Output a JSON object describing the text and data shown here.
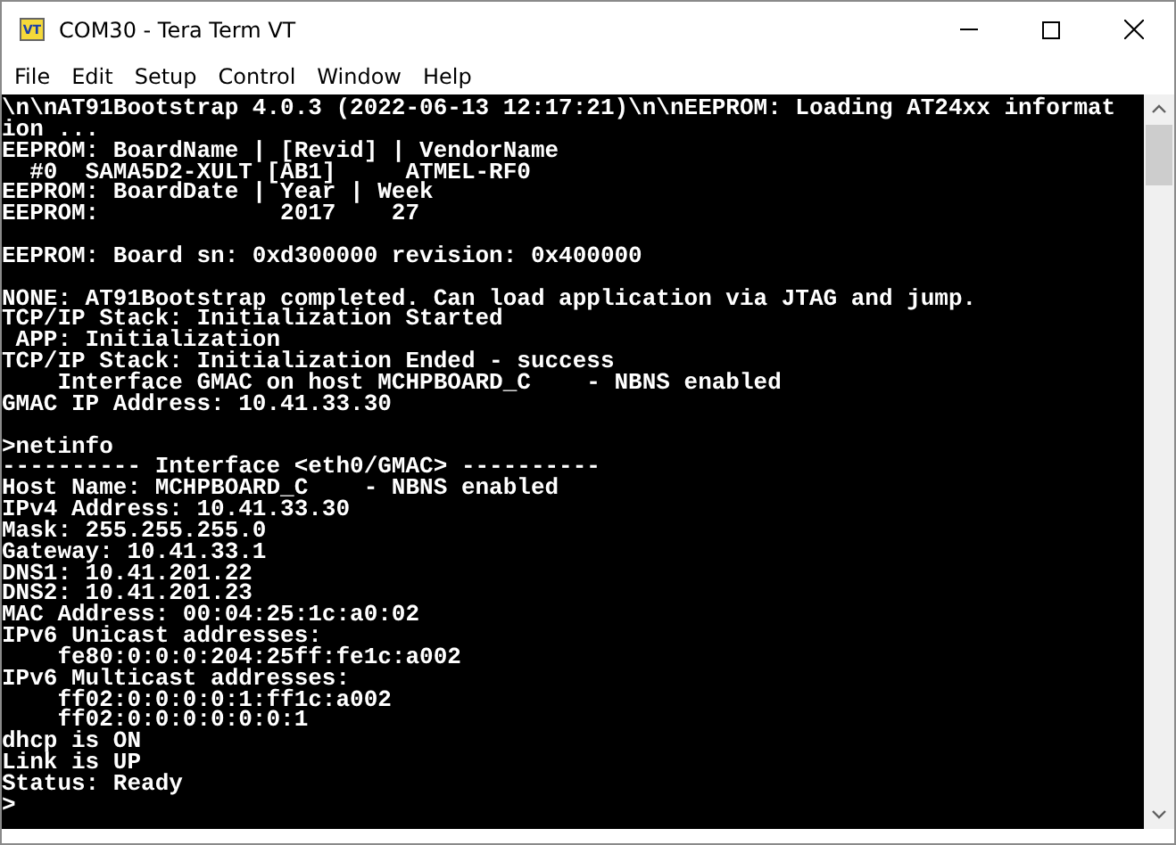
{
  "window": {
    "title": "COM30 - Tera Term VT",
    "app_icon": "VT"
  },
  "menu": [
    "File",
    "Edit",
    "Setup",
    "Control",
    "Window",
    "Help"
  ],
  "terminal": {
    "blocks": [
      [
        "\\n\\nAT91Bootstrap 4.0.3 (2022-06-13 12:17:21)\\n\\nEEPROM: Loading AT24xx informat",
        "ion ...",
        "EEPROM: BoardName | [Revid] | VendorName",
        "  #0  SAMA5D2-XULT [AB1]     ATMEL-RF0",
        "EEPROM: BoardDate | Year | Week",
        "EEPROM:             2017    27"
      ],
      [
        "EEPROM: Board sn: 0xd300000 revision: 0x400000"
      ],
      [
        "NONE: AT91Bootstrap completed. Can load application via JTAG and jump.",
        "TCP/IP Stack: Initialization Started",
        " APP: Initialization",
        "TCP/IP Stack: Initialization Ended - success",
        "    Interface GMAC on host MCHPBOARD_C    - NBNS enabled",
        "GMAC IP Address: 10.41.33.30"
      ],
      [
        ">netinfo",
        "---------- Interface <eth0/GMAC> ----------",
        "Host Name: MCHPBOARD_C    - NBNS enabled",
        "IPv4 Address: 10.41.33.30",
        "Mask: 255.255.255.0",
        "Gateway: 10.41.33.1",
        "DNS1: 10.41.201.22",
        "DNS2: 10.41.201.23",
        "MAC Address: 00:04:25:1c:a0:02",
        "IPv6 Unicast addresses:",
        "    fe80:0:0:0:204:25ff:fe1c:a002",
        "IPv6 Multicast addresses:",
        "    ff02:0:0:0:0:1:ff1c:a002",
        "    ff02:0:0:0:0:0:0:1",
        "dhcp is ON",
        "Link is UP",
        "Status: Ready",
        ">"
      ]
    ]
  }
}
